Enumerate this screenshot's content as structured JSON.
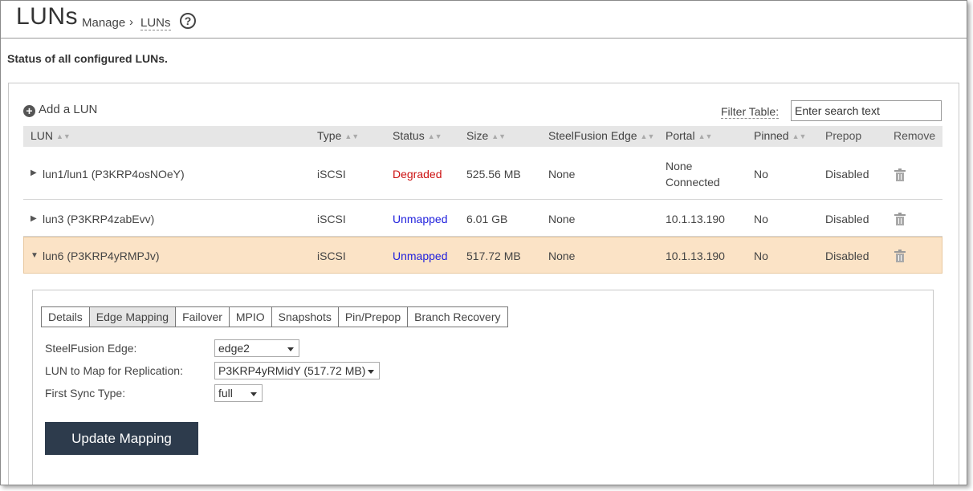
{
  "header": {
    "title": "LUNs",
    "breadcrumb_manage": "Manage",
    "breadcrumb_sep": "›",
    "breadcrumb_current": "LUNs",
    "help_icon": "?"
  },
  "subtitle": "Status of all configured LUNs.",
  "toolbar": {
    "add_lun_label": "Add a LUN",
    "filter_label": "Filter Table:",
    "filter_placeholder": "Enter search text"
  },
  "table": {
    "columns": [
      "LUN",
      "Type",
      "Status",
      "Size",
      "SteelFusion Edge",
      "Portal",
      "Pinned",
      "Prepop",
      "Remove"
    ],
    "rows": [
      {
        "lun": "lun1/lun1 (P3KRP4osNOeY)",
        "type": "iSCSI",
        "status": "Degraded",
        "size": "525.56 MB",
        "edge": "None",
        "portal_line1": "None",
        "portal_line2": "Connected",
        "pinned": "No",
        "prepop": "Disabled"
      },
      {
        "lun": "lun3 (P3KRP4zabEvv)",
        "type": "iSCSI",
        "status": "Unmapped",
        "size": "6.01 GB",
        "edge": "None",
        "portal_line1": "10.1.13.190",
        "pinned": "No",
        "prepop": "Disabled"
      },
      {
        "lun": "lun6 (P3KRP4yRMPJv)",
        "type": "iSCSI",
        "status": "Unmapped",
        "size": "517.72 MB",
        "edge": "None",
        "portal_line1": "10.1.13.190",
        "pinned": "No",
        "prepop": "Disabled"
      }
    ]
  },
  "detail": {
    "tabs": [
      "Details",
      "Edge Mapping",
      "Failover",
      "MPIO",
      "Snapshots",
      "Pin/Prepop",
      "Branch Recovery"
    ],
    "active_tab": "Edge Mapping",
    "form": {
      "edge_label": "SteelFusion Edge:",
      "edge_value": "edge2",
      "lun_map_label": "LUN to Map for Replication:",
      "lun_map_value": "P3KRP4yRMidY (517.72 MB)",
      "sync_label": "First Sync Type:",
      "sync_value": "full"
    },
    "update_button": "Update Mapping"
  },
  "colors": {
    "degraded": "#cc1111",
    "unmapped": "#2222dd",
    "selected_row": "#fbe3c6",
    "button": "#2d3b4c"
  }
}
